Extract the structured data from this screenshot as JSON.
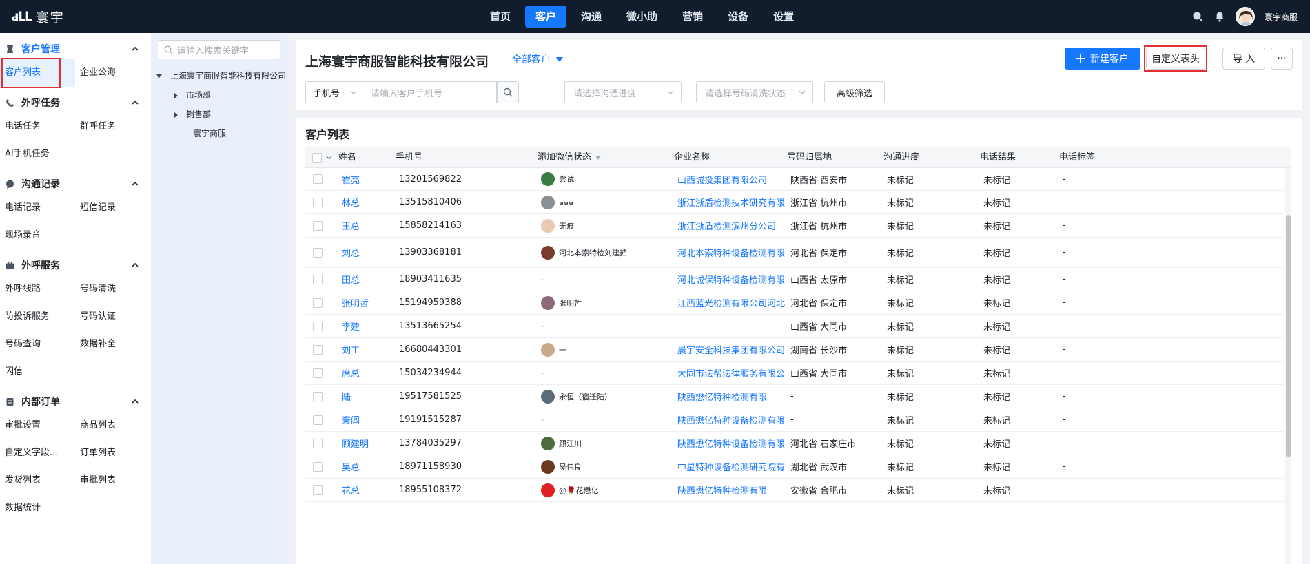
{
  "app": {
    "logo_text": "寰宇",
    "logo_mark": "ԁԼԼ"
  },
  "nav": [
    "首页",
    "客户",
    "沟通",
    "微小助",
    "营销",
    "设备",
    "设置"
  ],
  "nav_active": 1,
  "user": {
    "name": "寰宇商服"
  },
  "sidebar": {
    "groups": [
      {
        "label": "客户管理",
        "icon": "customer-icon",
        "active": true,
        "rows": [
          [
            "客户列表",
            "企业公海"
          ]
        ]
      },
      {
        "label": "外呼任务",
        "icon": "phone-icon",
        "active": false,
        "rows": [
          [
            "电话任务",
            "群呼任务"
          ],
          [
            "AI手机任务"
          ]
        ]
      },
      {
        "label": "沟通记录",
        "icon": "chat-icon",
        "active": false,
        "rows": [
          [
            "电话记录",
            "短信记录"
          ],
          [
            "现场录音"
          ]
        ]
      },
      {
        "label": "外呼服务",
        "icon": "briefcase-icon",
        "active": false,
        "rows": [
          [
            "外呼线路",
            "号码清洗"
          ],
          [
            "防投诉服务",
            "号码认证"
          ],
          [
            "号码查询",
            "数据补全"
          ],
          [
            "闪信"
          ]
        ]
      },
      {
        "label": "内部订单",
        "icon": "order-icon",
        "active": false,
        "rows": [
          [
            "审批设置",
            "商品列表"
          ],
          [
            "自定义字段...",
            "订单列表"
          ],
          [
            "发货列表",
            "审批列表"
          ],
          [
            "数据统计"
          ]
        ]
      }
    ],
    "active_item": "客户列表"
  },
  "tree": {
    "search_placeholder": "请输入搜索关键字",
    "root": "上海寰宇商服智能科技有限公司",
    "children": [
      "市场部",
      "销售部",
      "寰宇商服"
    ]
  },
  "header": {
    "company": "上海寰宇商服智能科技有限公司",
    "scope": "全部客户",
    "new_customer": "新建客户",
    "custom_header": "自定义表头",
    "import": "导 入",
    "more": "···"
  },
  "filters": {
    "field_type": "手机号",
    "phone_placeholder": "请输入客户手机号",
    "progress_placeholder": "请选择沟通进度",
    "clean_placeholder": "请选择号码清洗状态",
    "advanced": "高级筛选"
  },
  "list": {
    "title": "客户列表",
    "columns": [
      "姓名",
      "手机号",
      "添加微信状态",
      "企业名称",
      "号码归属地",
      "沟通进度",
      "电话结果",
      "电话标签"
    ],
    "rows": [
      {
        "name": "崔亮",
        "phone": "13201569822",
        "wx": "尝试",
        "wx_color": "#3a7d44",
        "company": "山西城投集团有限公司",
        "location": "陕西省 西安市",
        "progress": "未标记",
        "result": "未标记",
        "tag": "-"
      },
      {
        "name": "林总",
        "phone": "13515810406",
        "wx": "๑๑๑",
        "wx_color": "#8a8f96",
        "company": "浙江浙盾检测技术研究有限",
        "location": "浙江省 杭州市",
        "progress": "未标记",
        "result": "未标记",
        "tag": "-"
      },
      {
        "name": "王总",
        "phone": "15858214163",
        "wx": "无痕",
        "wx_color": "#e9c9b2",
        "company": "浙江浙盾检测滨州分公司",
        "location": "浙江省 杭州市",
        "progress": "未标记",
        "result": "未标记",
        "tag": "-"
      },
      {
        "name": "刘总",
        "phone": "13903368181",
        "wx": "河北本索特检刘建茹",
        "wx_color": "#7a3b2e",
        "company": "河北本索特种设备检测有限",
        "location": "河北省 保定市",
        "progress": "未标记",
        "result": "未标记",
        "tag": "-"
      },
      {
        "name": "田总",
        "phone": "18903411635",
        "wx": "-",
        "wx_color": "",
        "company": "河北城保特种设备检测有限",
        "location": "山西省 太原市",
        "progress": "未标记",
        "result": "未标记",
        "tag": "-"
      },
      {
        "name": "张明哲",
        "phone": "15194959388",
        "wx": "张明哲",
        "wx_color": "#8c6a7a",
        "company": "江西蓝光检测有限公司河北",
        "location": "河北省 保定市",
        "progress": "未标记",
        "result": "未标记",
        "tag": "-"
      },
      {
        "name": "李建",
        "phone": "13513665254",
        "wx": "-",
        "wx_color": "",
        "company": "-",
        "location": "山西省 大同市",
        "progress": "未标记",
        "result": "未标记",
        "tag": "-"
      },
      {
        "name": "刘工",
        "phone": "16680443301",
        "wx": "一",
        "wx_color": "#c9a98a",
        "company": "晨宇安全科技集团有限公司",
        "location": "湖南省 长沙市",
        "progress": "未标记",
        "result": "未标记",
        "tag": "-"
      },
      {
        "name": "席总",
        "phone": "15034234944",
        "wx": "-",
        "wx_color": "",
        "company": "大同市法帮法律服务有限公",
        "location": "山西省 大同市",
        "progress": "未标记",
        "result": "未标记",
        "tag": "-"
      },
      {
        "name": "陆",
        "phone": "19517581525",
        "wx": "永恒（宿迁陆）",
        "wx_color": "#5b6b78",
        "company": "陕西懋亿特种检测有限",
        "location": "-",
        "progress": "未标记",
        "result": "未标记",
        "tag": "-"
      },
      {
        "name": "寰闾",
        "phone": "19191515287",
        "wx": "-",
        "wx_color": "",
        "company": "陕西懋亿特种设备检测有限",
        "location": "-",
        "progress": "未标记",
        "result": "未标记",
        "tag": "-"
      },
      {
        "name": "顾建明",
        "phone": "13784035297",
        "wx": "顾江川",
        "wx_color": "#4f6a3c",
        "company": "陕西懋亿特种设备检测有限",
        "location": "河北省 石家庄市",
        "progress": "未标记",
        "result": "未标记",
        "tag": "-"
      },
      {
        "name": "吴总",
        "phone": "18971158930",
        "wx": "吴伟良",
        "wx_color": "#6b3a1e",
        "company": "中星特种设备检测研究院有",
        "location": "湖北省 武汉市",
        "progress": "未标记",
        "result": "未标记",
        "tag": "-"
      },
      {
        "name": "花总",
        "phone": "18955108372",
        "wx": "@🌹花懋亿",
        "wx_color": "#e02020",
        "company": "陕西懋亿特种检测有限",
        "location": "安徽省 合肥市",
        "progress": "未标记",
        "result": "未标记",
        "tag": "-"
      }
    ]
  },
  "colors": {
    "topbar": "#111c2d",
    "accent": "#1677ff",
    "highlight_box": "#e03131"
  }
}
